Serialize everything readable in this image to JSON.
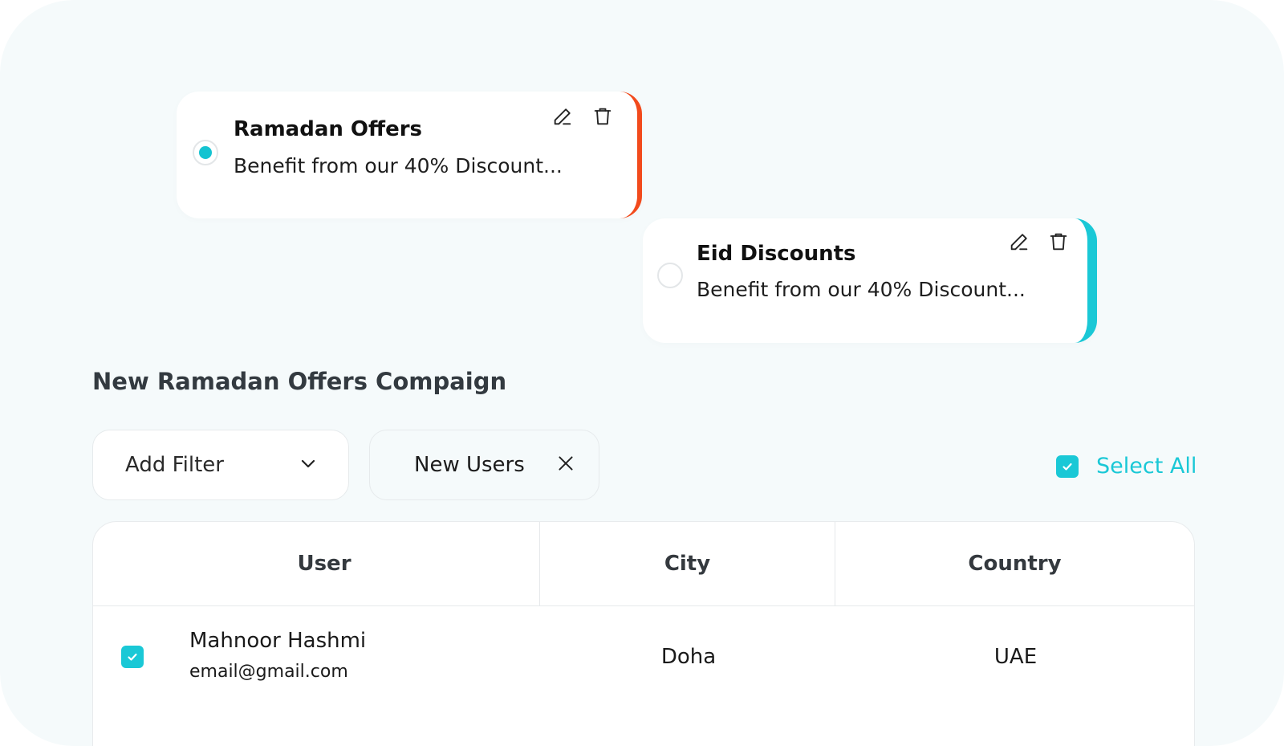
{
  "offers": [
    {
      "title": "Ramadan Offers",
      "description": "Benefit from our 40% Discount...",
      "selected": true,
      "accent_color": "#f24a1c",
      "icons": [
        "pencil-icon",
        "trash-icon"
      ]
    },
    {
      "title": "Eid Discounts",
      "description": "Benefit from our 40% Discount...",
      "selected": false,
      "accent_color": "#1ac8d6",
      "icons": [
        "pencil-icon",
        "trash-icon"
      ]
    }
  ],
  "campaign": {
    "title": "New Ramadan Offers Compaign"
  },
  "filters": {
    "add_filter_label": "Add Filter",
    "add_filter_icon": "chevron-down-icon",
    "active_chip_label": "New Users",
    "chip_remove_icon": "close-icon",
    "select_all_label": "Select All",
    "select_all_checked": true
  },
  "table": {
    "columns": [
      "User",
      "City",
      "Country"
    ],
    "rows": [
      {
        "checked": true,
        "name": "Mahnoor Hashmi",
        "email": "email@gmail.com",
        "city": "Doha",
        "country": "UAE"
      }
    ]
  },
  "colors": {
    "accent": "#1ac8d6",
    "orange": "#f24a1c",
    "background": "#f5fafb"
  }
}
